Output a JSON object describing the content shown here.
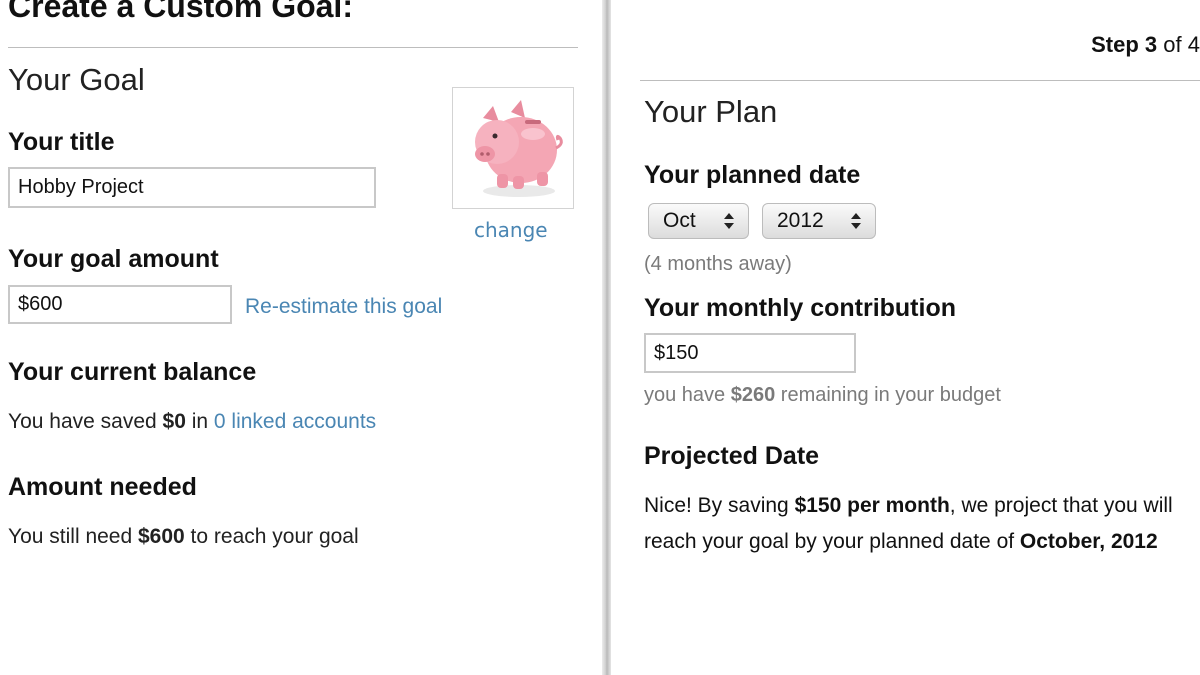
{
  "page": {
    "title": "Create a Custom Goal:"
  },
  "step": {
    "prefix": "Step ",
    "current": "3",
    "separator": " of ",
    "total": "4"
  },
  "goal": {
    "section_title": "Your Goal",
    "title_label": "Your title",
    "title_value": "Hobby Project",
    "image_change_label": "change",
    "amount_label": "Your goal amount",
    "amount_value": "$600",
    "reestimate_label": "Re-estimate this goal",
    "balance_label": "Your current balance",
    "balance_pre": "You have saved ",
    "balance_amount": "$0",
    "balance_mid": " in ",
    "balance_link": "0 linked accounts",
    "needed_label": "Amount needed",
    "needed_pre": "You still need ",
    "needed_amount": "$600",
    "needed_post": " to reach your goal"
  },
  "plan": {
    "section_title": "Your Plan",
    "date_label": "Your planned date",
    "month_value": "Oct",
    "year_value": "2012",
    "months_away": "(4 months away)",
    "contribution_label": "Your monthly contribution",
    "contribution_value": "$150",
    "budget_pre": "you have ",
    "budget_amount": "$260",
    "budget_post": " remaining in your budget",
    "projected_label": "Projected Date",
    "projected_pre": "Nice! By saving ",
    "projected_bold": "$150 per month",
    "projected_post": ", we project that you will reach your goal by your planned date of ",
    "projected_date": "October, 2012"
  },
  "icons": {
    "goal_image": "piggy-bank-icon",
    "select_arrows": "up-down-arrows-icon"
  },
  "colors": {
    "link": "#4a86b3",
    "piggy": "#f4a6b4"
  }
}
